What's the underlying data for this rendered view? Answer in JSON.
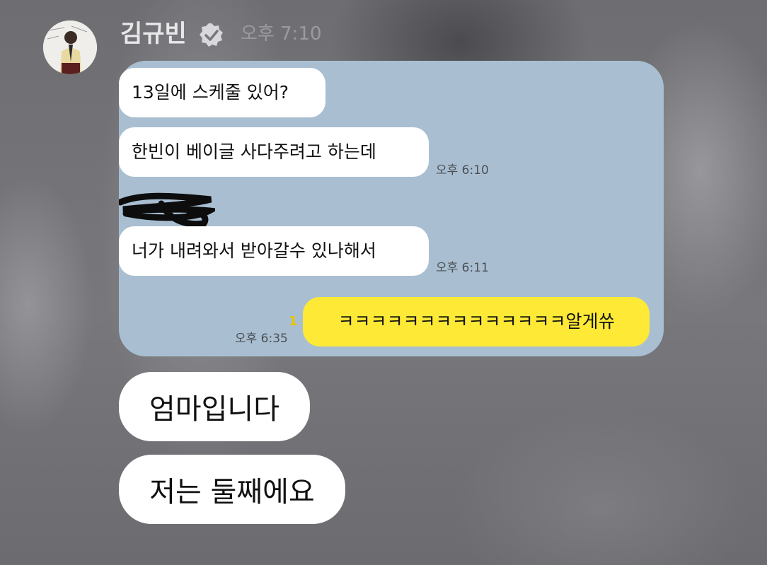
{
  "header": {
    "sender_name": "김규빈",
    "time": "오후 7:10"
  },
  "icons": {
    "verified": "verified-check-icon",
    "avatar": "profile-photo"
  },
  "messages": [
    {
      "text": "13일에 스케줄 있어?"
    },
    {
      "text": "한빈이 베이글 사다주려고 하는데",
      "time": "오후 6:10"
    },
    {
      "text": "너가 내려와서 받아갈수 있나해서",
      "time": "오후 6:11"
    },
    {
      "text": "ㅋㅋㅋㅋㅋㅋㅋㅋㅋㅋㅋㅋㅋㅋ알게쓔",
      "time": "오후 6:35",
      "unread": "1"
    }
  ],
  "reply_bubbles": [
    {
      "text": "엄마입니다"
    },
    {
      "text": "저는 둘째에요"
    }
  ],
  "colors": {
    "panel_bg": "#a9bfd1",
    "incoming_bubble": "#ffffff",
    "outgoing_bubble": "#fde936",
    "unread_count": "#e3c400"
  }
}
